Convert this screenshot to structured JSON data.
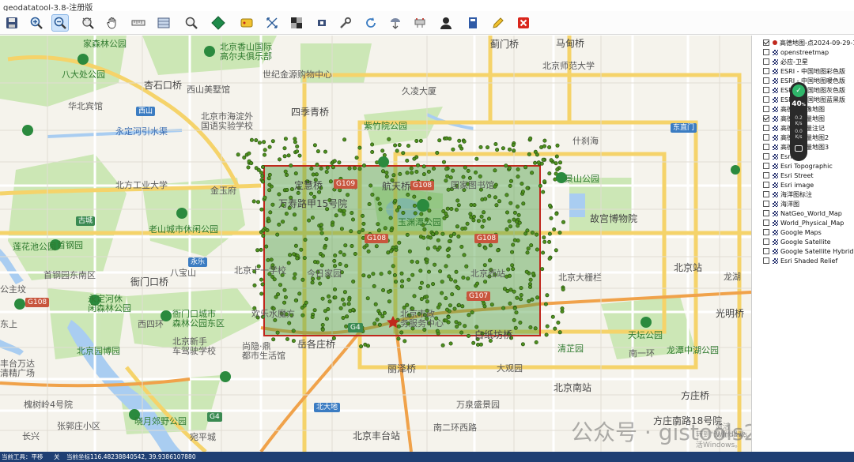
{
  "window": {
    "title": "geodatatool-3.8-注册版"
  },
  "toolbar": {
    "buttons": [
      {
        "name": "save-button",
        "icon": "save-icon"
      },
      {
        "name": "zoom-in-button",
        "icon": "zoom-in-icon"
      },
      {
        "name": "zoom-out-button",
        "icon": "zoom-out-icon"
      },
      {
        "name": "full-extent-button",
        "icon": "full-extent-icon"
      },
      {
        "name": "pan-button",
        "icon": "hand-icon"
      },
      {
        "name": "measure-distance-button",
        "icon": "ruler-icon"
      },
      {
        "name": "measure-area-button",
        "icon": "area-ruler-icon"
      },
      {
        "name": "identify-button",
        "icon": "magnifier-icon"
      },
      {
        "name": "layer-style-button",
        "icon": "diamond-icon"
      },
      {
        "name": "label-button",
        "icon": "label-tag-icon"
      },
      {
        "name": "select-tool-button",
        "icon": "select-arrows-icon"
      },
      {
        "name": "grid-button",
        "icon": "checker-grid-icon"
      },
      {
        "name": "clear-selection-button",
        "icon": "eraser-icon"
      },
      {
        "name": "tools-button",
        "icon": "wrench-icon"
      },
      {
        "name": "refresh-button",
        "icon": "refresh-icon"
      },
      {
        "name": "download-button",
        "icon": "download-icon"
      },
      {
        "name": "network-button",
        "icon": "network-icon"
      },
      {
        "name": "user-button",
        "icon": "user-icon"
      },
      {
        "name": "book-button",
        "icon": "book-icon"
      },
      {
        "name": "edit-button",
        "icon": "pencil-icon"
      },
      {
        "name": "close-button",
        "icon": "close-icon"
      }
    ]
  },
  "map": {
    "labels": [
      {
        "name": "label-jiasen-park",
        "text": "家森林公园",
        "style": "green"
      },
      {
        "name": "label-badachu-park",
        "text": "八大处公园",
        "style": "green"
      },
      {
        "name": "label-shijingshan-xiangshan-club",
        "text": "北京香山国际\n高尔夫俱乐部",
        "style": "green"
      },
      {
        "name": "label-xingshiqiao",
        "text": "杏石口桥",
        "style": "dark"
      },
      {
        "name": "label-xishan-art",
        "text": "西山美墅馆",
        "style": ""
      },
      {
        "name": "label-century-museum",
        "text": "世纪金源购物中心",
        "style": ""
      },
      {
        "name": "label-jiuling",
        "text": "久凌大厦",
        "style": ""
      },
      {
        "name": "label-jimenqiao",
        "text": "蓟门桥",
        "style": "dark"
      },
      {
        "name": "label-mamenqiao",
        "text": "马甸桥",
        "style": "dark"
      },
      {
        "name": "label-bnu",
        "text": "北京师范大学",
        "style": ""
      },
      {
        "name": "label-huabin",
        "text": "华北宾馆",
        "style": ""
      },
      {
        "name": "label-xiyuan",
        "text": "西山",
        "style": "shieldbl"
      },
      {
        "name": "label-haidian-school",
        "text": "北京市海淀外\n国语实验学校",
        "style": ""
      },
      {
        "name": "label-sijiqing",
        "text": "四季青桥",
        "style": "dark"
      },
      {
        "name": "label-ziyuqiao",
        "text": "紫竹院公园",
        "style": "green"
      },
      {
        "name": "label-yongding-river",
        "text": "永定河引水渠",
        "style": "blue"
      },
      {
        "name": "label-shichahai",
        "text": "什刹海",
        "style": ""
      },
      {
        "name": "label-dongzhimen",
        "text": "东直门",
        "style": "shieldbl"
      },
      {
        "name": "label-beifang-industry",
        "text": "北方工业大学",
        "style": ""
      },
      {
        "name": "label-jinyufu",
        "text": "金玉府",
        "style": ""
      },
      {
        "name": "label-dingqiao",
        "text": "定慧桥",
        "style": "dark"
      },
      {
        "name": "label-hangtianqiao",
        "text": "航天桥",
        "style": "dark"
      },
      {
        "name": "label-guojiao",
        "text": "国家图书馆",
        "style": ""
      },
      {
        "name": "label-jingshan",
        "text": "景山公园",
        "style": "green"
      },
      {
        "name": "label-wanshou",
        "text": "万寿路甲15号院",
        "style": "dark"
      },
      {
        "name": "label-yuyuantan",
        "text": "玉渊潭公园",
        "style": "green"
      },
      {
        "name": "label-gugong",
        "text": "故宫博物院",
        "style": "dark"
      },
      {
        "name": "label-gucheng",
        "text": "古城",
        "style": "shieldg"
      },
      {
        "name": "label-laoshan",
        "text": "老山城市休闲公园",
        "style": "green"
      },
      {
        "name": "label-shougang",
        "text": "首钢园",
        "style": "green"
      },
      {
        "name": "label-shougang-east",
        "text": "首钢园东南区",
        "style": ""
      },
      {
        "name": "label-yongle",
        "text": "永乐",
        "style": "shieldbl"
      },
      {
        "name": "label-babaoshan",
        "text": "八宝山",
        "style": ""
      },
      {
        "name": "label-wukesong",
        "text": "北京十一学校",
        "style": ""
      },
      {
        "name": "label-gongzhufen",
        "text": "公主坟",
        "style": ""
      },
      {
        "name": "label-jinmenxi",
        "text": "今日家园",
        "style": ""
      },
      {
        "name": "label-dongdan",
        "text": "北京大栅栏",
        "style": ""
      },
      {
        "name": "label-beijingzhan",
        "text": "北京站",
        "style": "dark"
      },
      {
        "name": "label-longhu",
        "text": "龙湖",
        "style": ""
      },
      {
        "name": "label-yongding-park",
        "text": "永定河休\n闲森林公园",
        "style": "green"
      },
      {
        "name": "label-jiemen",
        "text": "衙门口桥",
        "style": "dark"
      },
      {
        "name": "label-lianhuachi",
        "text": "莲花池公园",
        "style": "green"
      },
      {
        "name": "label-xuanwu",
        "text": "北京西站",
        "style": ""
      },
      {
        "name": "label-shijie-park",
        "text": "衙门口城市\n森林公园东区",
        "style": "green"
      },
      {
        "name": "label-world-water",
        "text": "欢乐水魔方",
        "style": ""
      },
      {
        "name": "label-beijing-gov",
        "text": "北京市政\n务服务中心",
        "style": ""
      },
      {
        "name": "label-tiantan",
        "text": "天坛公园",
        "style": "green"
      },
      {
        "name": "label-guangming",
        "text": "光明桥",
        "style": "dark"
      },
      {
        "name": "label-dongshang",
        "text": "东上",
        "style": ""
      },
      {
        "name": "label-xisi",
        "text": "西四环",
        "style": ""
      },
      {
        "name": "label-driving-school",
        "text": "北京新手\n车驾驶学校",
        "style": ""
      },
      {
        "name": "label-shangma",
        "text": "尚隐·鼎\n都市生活馆",
        "style": ""
      },
      {
        "name": "label-yuecheng",
        "text": "岳各庄桥",
        "style": "dark"
      },
      {
        "name": "label-baizhiqiao",
        "text": "白纸坊桥",
        "style": "dark"
      },
      {
        "name": "label-qingjing",
        "text": "清芷园",
        "style": "green"
      },
      {
        "name": "label-longtan",
        "text": "龙潭中湖公园",
        "style": "green"
      },
      {
        "name": "label-nanyihuan",
        "text": "南一环",
        "style": ""
      },
      {
        "name": "label-beijing-garden",
        "text": "北京园博园",
        "style": "green"
      },
      {
        "name": "label-fengtai-wanda",
        "text": "丰台万达\n清精广场",
        "style": ""
      },
      {
        "name": "label-lijiaoqiao",
        "text": "丽泽桥",
        "style": "dark"
      },
      {
        "name": "label-dagong",
        "text": "大观园",
        "style": ""
      },
      {
        "name": "label-fangzhuang",
        "text": "方庄桥",
        "style": "dark"
      },
      {
        "name": "label-huailingling",
        "text": "槐树岭4号院",
        "style": ""
      },
      {
        "name": "label-xiaoyue",
        "text": "晓月郊野公园",
        "style": "green"
      },
      {
        "name": "label-beidadi",
        "text": "北大地",
        "style": "shieldbl"
      },
      {
        "name": "label-wanquan",
        "text": "万泉盛景园",
        "style": ""
      },
      {
        "name": "label-beijingnanzhan",
        "text": "北京南站",
        "style": "dark"
      },
      {
        "name": "label-zhangguozhuang",
        "text": "张郭庄小区",
        "style": ""
      },
      {
        "name": "label-wanping",
        "text": "宛平城",
        "style": ""
      },
      {
        "name": "label-beijing-fengtai",
        "text": "北京丰台站",
        "style": "dark"
      },
      {
        "name": "label-nanerhuan",
        "text": "南二环西路",
        "style": ""
      },
      {
        "name": "label-fangzhuang18",
        "text": "方庄南路18号院",
        "style": "dark"
      },
      {
        "name": "label-changxing",
        "text": "长兴",
        "style": ""
      }
    ],
    "shields": [
      "G109",
      "G108",
      "G108",
      "G108",
      "G107",
      "G4",
      "G4",
      "G108"
    ]
  },
  "layers": [
    {
      "label": "高德地图-点2024-09-29-17-0",
      "checked": true,
      "icon": "point-layer-icon"
    },
    {
      "label": "openstreetmap",
      "checked": false,
      "icon": "tile-layer-icon"
    },
    {
      "label": "必应-卫星",
      "checked": false,
      "icon": "tile-layer-icon"
    },
    {
      "label": "ESRI - 中国地图彩色版",
      "checked": false,
      "icon": "tile-layer-icon"
    },
    {
      "label": "ESRI - 中国地图暖色版",
      "checked": false,
      "icon": "tile-layer-icon"
    },
    {
      "label": "ESRI - 中国地图灰色版",
      "checked": false,
      "icon": "tile-layer-icon"
    },
    {
      "label": "ESRI - 中国地图蓝黑版",
      "checked": false,
      "icon": "tile-layer-icon"
    },
    {
      "label": "高德 - 影像地图",
      "checked": false,
      "icon": "tile-layer-icon"
    },
    {
      "label": "高德 - 矢量地图",
      "checked": true,
      "icon": "tile-layer-icon"
    },
    {
      "label": "高德 - 矢量注记",
      "checked": false,
      "icon": "tile-layer-icon"
    },
    {
      "label": "高德 - 矢量地图2",
      "checked": false,
      "icon": "tile-layer-icon"
    },
    {
      "label": "高德 - 矢量地图3",
      "checked": false,
      "icon": "tile-layer-icon"
    },
    {
      "label": "Esri",
      "checked": false,
      "icon": "tile-layer-icon"
    },
    {
      "label": "Esri Topographic",
      "checked": false,
      "icon": "tile-layer-icon"
    },
    {
      "label": "Esri Street",
      "checked": false,
      "icon": "tile-layer-icon"
    },
    {
      "label": "Esri image",
      "checked": false,
      "icon": "tile-layer-icon"
    },
    {
      "label": "海洋图标注",
      "checked": false,
      "icon": "tile-layer-icon"
    },
    {
      "label": "海洋图",
      "checked": false,
      "icon": "tile-layer-icon"
    },
    {
      "label": "NatGeo_World_Map",
      "checked": false,
      "icon": "tile-layer-icon"
    },
    {
      "label": "World_Physical_Map",
      "checked": false,
      "icon": "tile-layer-icon"
    },
    {
      "label": "Google Maps",
      "checked": false,
      "icon": "tile-layer-icon"
    },
    {
      "label": "Google Satellite",
      "checked": false,
      "icon": "tile-layer-icon"
    },
    {
      "label": "Google Satellite Hybrid",
      "checked": false,
      "icon": "tile-layer-icon"
    },
    {
      "label": "Esri Shaded Relief",
      "checked": false,
      "icon": "tile-layer-icon"
    }
  ],
  "widget": {
    "percent": "40",
    "percent_unit": "%",
    "up": "0.2",
    "up_unit": "K/s",
    "down": "0.0",
    "down_unit": "K/s"
  },
  "watermark": {
    "text": "公众号 · gistools2021",
    "activate": "激活 Windows",
    "activate_sub": "转到\"设置\"以激活Windows。"
  },
  "statusbar": {
    "tool": "当前工具：平移",
    "state": "关",
    "coords": "当前坐标116.48238840542, 39.9386107880"
  },
  "colors": {
    "selection_rect": "#c0281d",
    "selection_fill": "rgba(80,160,70,0.45)",
    "points": "#4f8f1f",
    "statusbar": "#1f3f73"
  }
}
